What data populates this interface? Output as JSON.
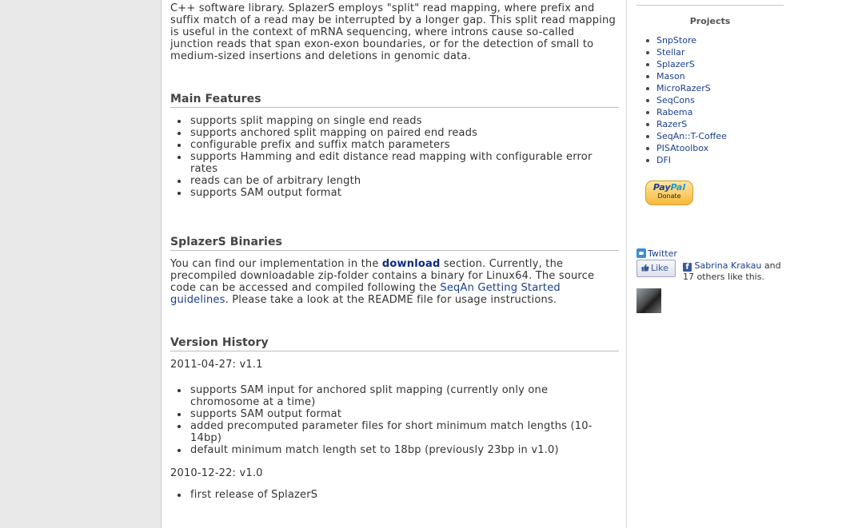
{
  "main": {
    "intro_lines": [
      "C++ software library. SplazerS employs \"split\" read mapping, where prefix and",
      "suffix match of a read may be interrupted by a longer gap. This split read mapping",
      "is useful in the context of mRNA sequencing, where introns cause so-called",
      "junction reads that span exon-exon boundaries, or for the detection of small to",
      "medium-sized insertions and deletions in genomic data."
    ],
    "features": {
      "heading": "Main Features",
      "items": [
        "supports split mapping on single end reads",
        "supports anchored split mapping on paired end reads",
        "configurable prefix and suffix match parameters",
        "supports Hamming and edit distance read mapping with configurable error rates",
        "reads can be of arbitrary length",
        "supports SAM output format"
      ]
    },
    "binaries": {
      "heading": "SplazerS Binaries",
      "text_1": "You can find our implementation in the ",
      "download_link": "download",
      "text_2": " section. Currently, the precompiled downloadable zip-folder contains a binary for Linux64. The source code can be accessed and compiled following the ",
      "guide_link": "SeqAn Getting Started guidelines",
      "text_3": ". Please take a look at the README file for usage instructions."
    },
    "history": {
      "heading": "Version History",
      "releases": [
        {
          "date": "2011-04-27: v1.1",
          "items": [
            "supports SAM input for anchored split mapping (currently only one chromosome at a time)",
            "supports SAM output format",
            "added precomputed parameter files for short minimum match lengths (10-14bp)",
            "default minimum match length set to 18bp (previously 23bp in v1.0)"
          ]
        },
        {
          "date": "2010-12-22: v1.0",
          "items": [
            "first release of SplazerS"
          ]
        }
      ]
    }
  },
  "sidebar": {
    "projects_title": "Projects",
    "projects": [
      "SnpStore",
      "Stellar",
      "SplazerS",
      "Mason",
      "MicroRazerS",
      "SeqCons",
      "Rabema",
      "RazerS",
      "SeqAn::T-Coffee",
      "PISAtoolbox",
      "DFI"
    ],
    "paypal": {
      "logo_1": "Pay",
      "logo_2": "Pal",
      "donate": "Donate"
    },
    "twitter_label": "Twitter",
    "like_label": "Like",
    "fb_icon": "f",
    "fb_person": "Sabrina Krakau",
    "fb_text_1": " and",
    "fb_text_2": "17 others like this."
  },
  "colors": {
    "link": "#1a3e8c",
    "page_bg": "#e9e9e9",
    "content_bg": "#ffffff"
  }
}
